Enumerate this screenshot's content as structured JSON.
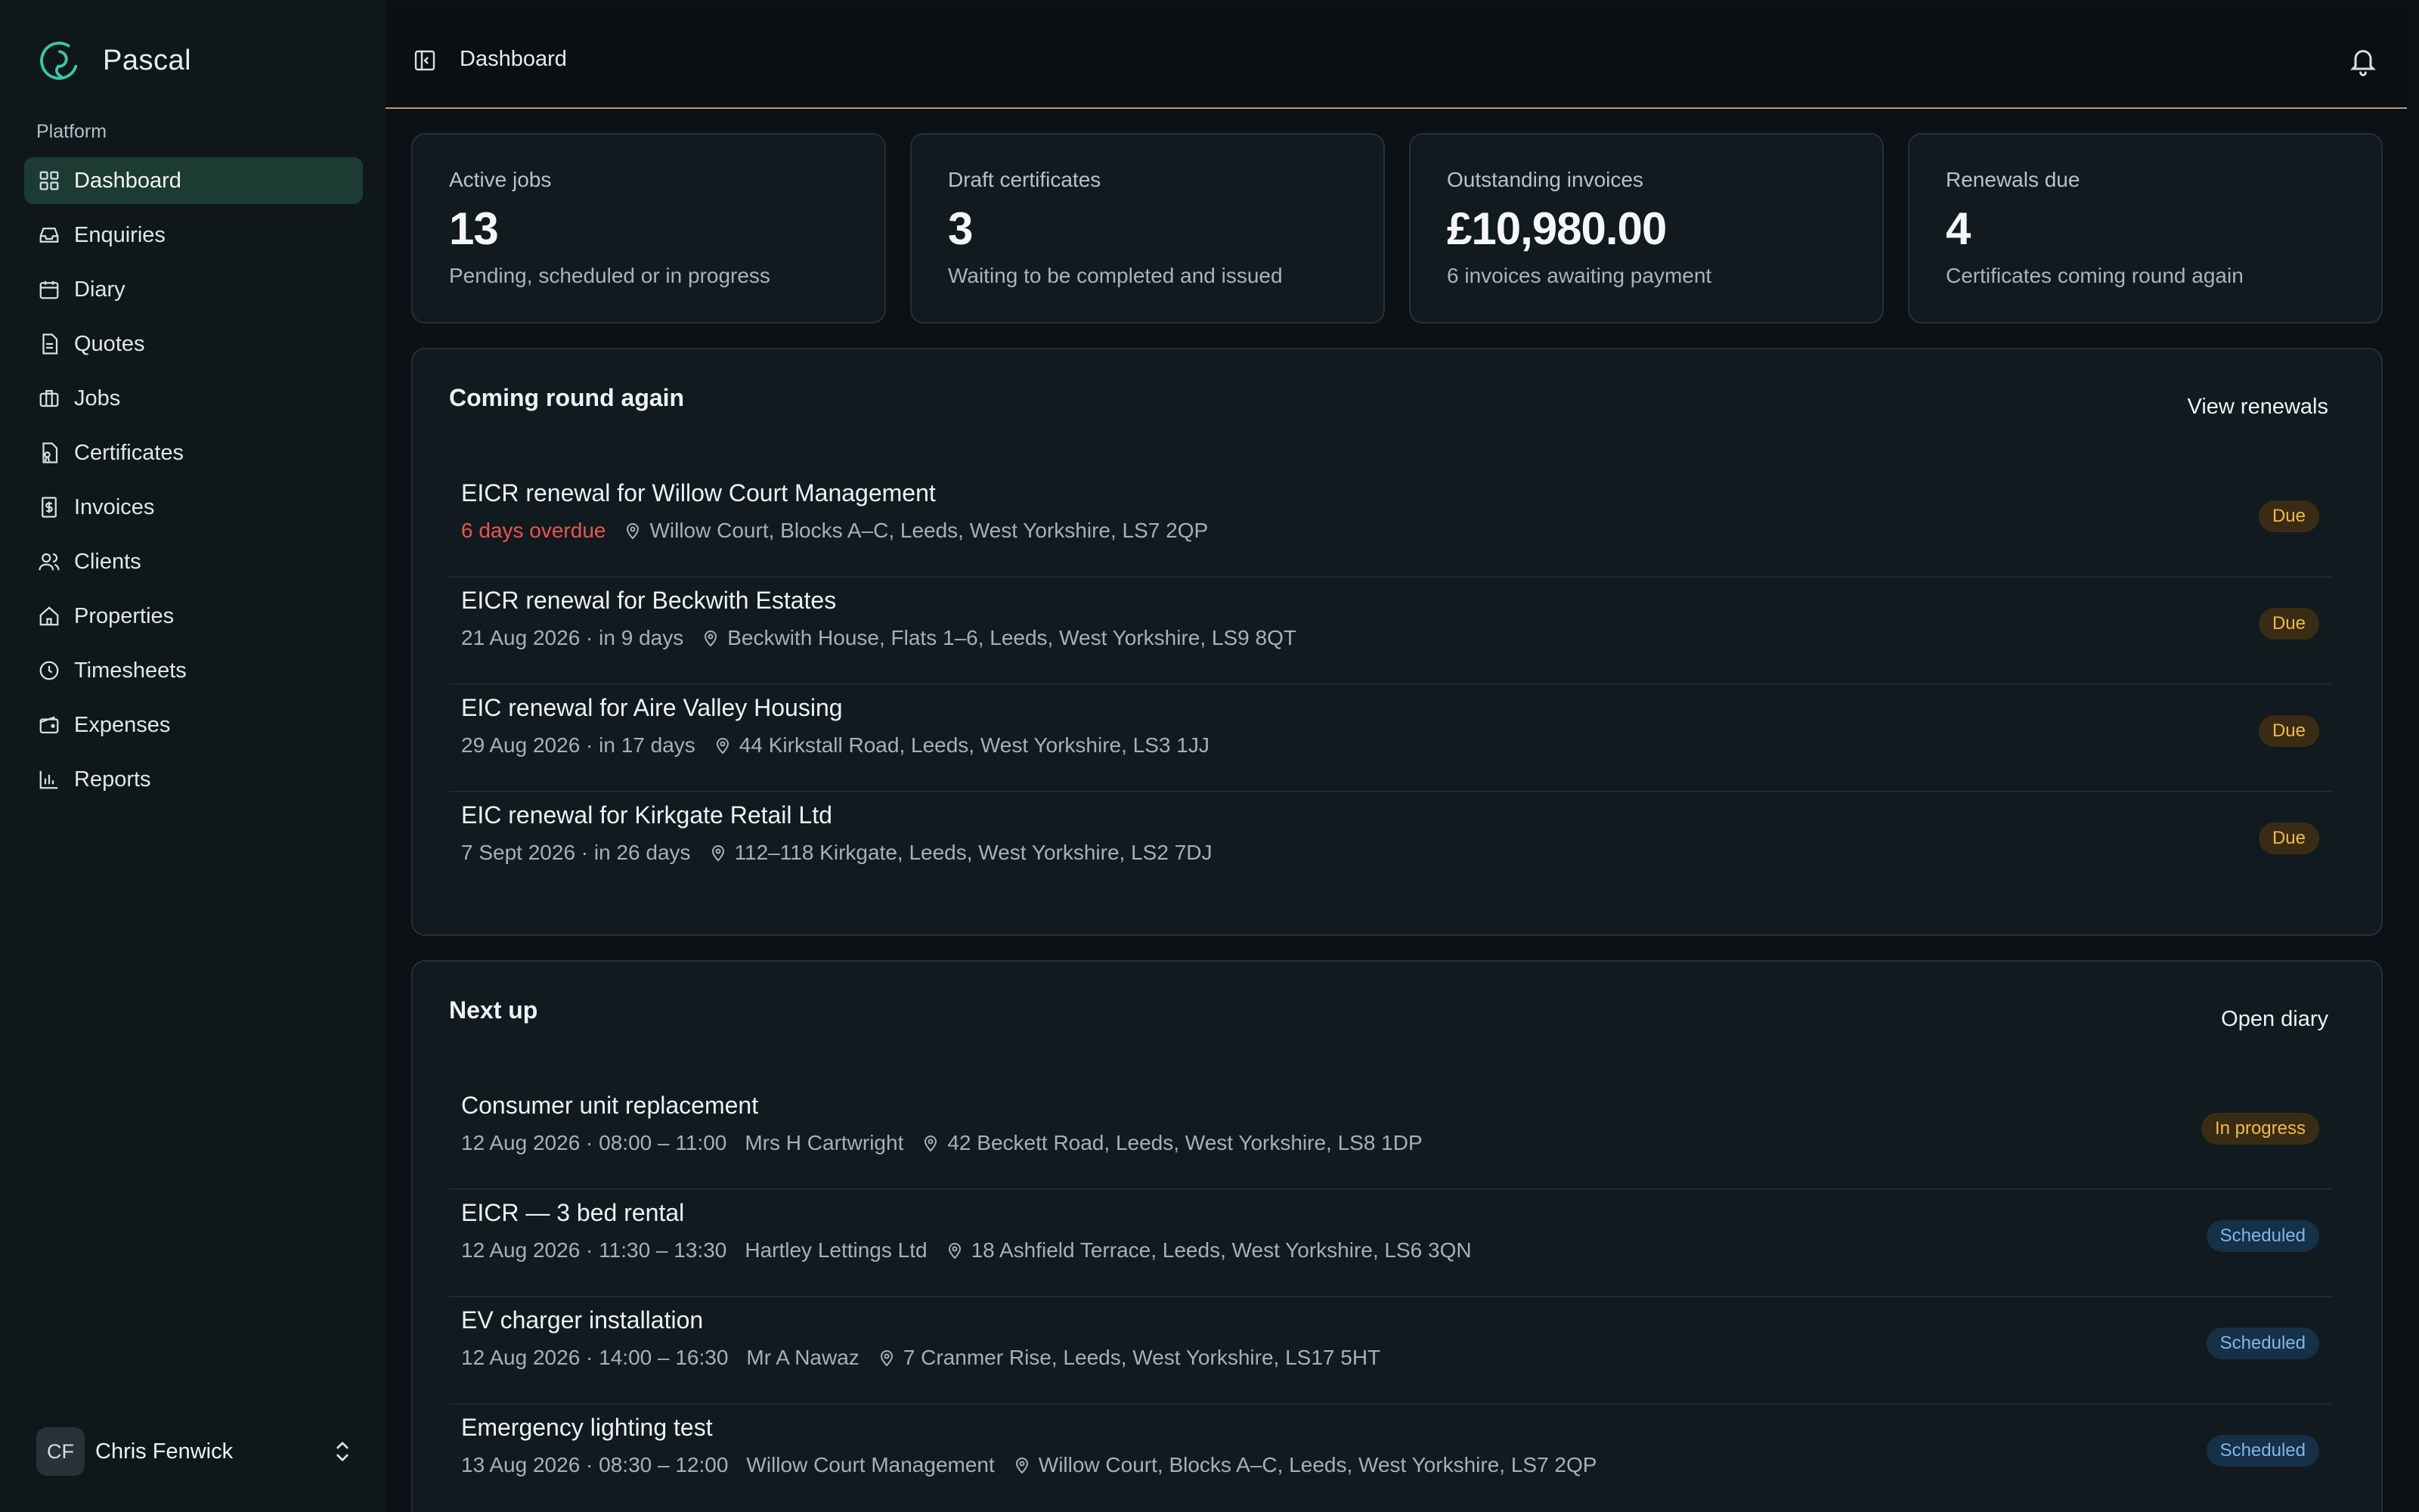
{
  "app": {
    "name": "Pascal"
  },
  "sidebar": {
    "section_label": "Platform",
    "items": [
      {
        "label": "Dashboard",
        "icon": "dashboard-icon"
      },
      {
        "label": "Enquiries",
        "icon": "inbox-icon"
      },
      {
        "label": "Diary",
        "icon": "calendar-icon"
      },
      {
        "label": "Quotes",
        "icon": "document-icon"
      },
      {
        "label": "Jobs",
        "icon": "briefcase-icon"
      },
      {
        "label": "Certificates",
        "icon": "certificate-icon"
      },
      {
        "label": "Invoices",
        "icon": "invoice-icon"
      },
      {
        "label": "Clients",
        "icon": "users-icon"
      },
      {
        "label": "Properties",
        "icon": "home-icon"
      },
      {
        "label": "Timesheets",
        "icon": "clock-icon"
      },
      {
        "label": "Expenses",
        "icon": "wallet-icon"
      },
      {
        "label": "Reports",
        "icon": "bar-chart-icon"
      }
    ],
    "user": {
      "initials": "CF",
      "name": "Chris Fenwick"
    }
  },
  "header": {
    "title": "Dashboard"
  },
  "stats": [
    {
      "label": "Active jobs",
      "value": "13",
      "sub": "Pending, scheduled or in progress"
    },
    {
      "label": "Draft certificates",
      "value": "3",
      "sub": "Waiting to be completed and issued"
    },
    {
      "label": "Outstanding invoices",
      "value": "£10,980.00",
      "sub": "6 invoices awaiting payment"
    },
    {
      "label": "Renewals due",
      "value": "4",
      "sub": "Certificates coming round again"
    }
  ],
  "renewals": {
    "title": "Coming round again",
    "link": "View renewals",
    "items": [
      {
        "title": "EICR renewal for Willow Court Management",
        "when": "6 days overdue",
        "address": "Willow Court, Blocks A–C, Leeds, West Yorkshire, LS7 2QP",
        "badge": "Due"
      },
      {
        "title": "EICR renewal for Beckwith Estates",
        "when": "21 Aug 2026 · in 9 days",
        "address": "Beckwith House, Flats 1–6, Leeds, West Yorkshire, LS9 8QT",
        "badge": "Due"
      },
      {
        "title": "EIC renewal for Aire Valley Housing",
        "when": "29 Aug 2026 · in 17 days",
        "address": "44 Kirkstall Road, Leeds, West Yorkshire, LS3 1JJ",
        "badge": "Due"
      },
      {
        "title": "EIC renewal for Kirkgate Retail Ltd",
        "when": "7 Sept 2026 · in 26 days",
        "address": "112–118 Kirkgate, Leeds, West Yorkshire, LS2 7DJ",
        "badge": "Due"
      }
    ]
  },
  "next_up": {
    "title": "Next up",
    "link": "Open diary",
    "items": [
      {
        "title": "Consumer unit replacement",
        "when": "12 Aug 2026 · 08:00 – 11:00",
        "client": "Mrs H Cartwright",
        "address": "42 Beckett Road, Leeds, West Yorkshire, LS8 1DP",
        "badge": "In progress"
      },
      {
        "title": "EICR — 3 bed rental",
        "when": "12 Aug 2026 · 11:30 – 13:30",
        "client": "Hartley Lettings Ltd",
        "address": "18 Ashfield Terrace, Leeds, West Yorkshire, LS6 3QN",
        "badge": "Scheduled"
      },
      {
        "title": "EV charger installation",
        "when": "12 Aug 2026 · 14:00 – 16:30",
        "client": "Mr A Nawaz",
        "address": "7 Cranmer Rise, Leeds, West Yorkshire, LS17 5HT",
        "badge": "Scheduled"
      },
      {
        "title": "Emergency lighting test",
        "when": "13 Aug 2026 · 08:30 – 12:00",
        "client": "Willow Court Management",
        "address": "Willow Court, Blocks A–C, Leeds, West Yorkshire, LS7 2QP",
        "badge": "Scheduled"
      }
    ]
  },
  "colors": {
    "accent": "#1c3b33",
    "overdue": "#e8554e",
    "due": "#f0b94b",
    "scheduled": "#7fb6ea"
  }
}
